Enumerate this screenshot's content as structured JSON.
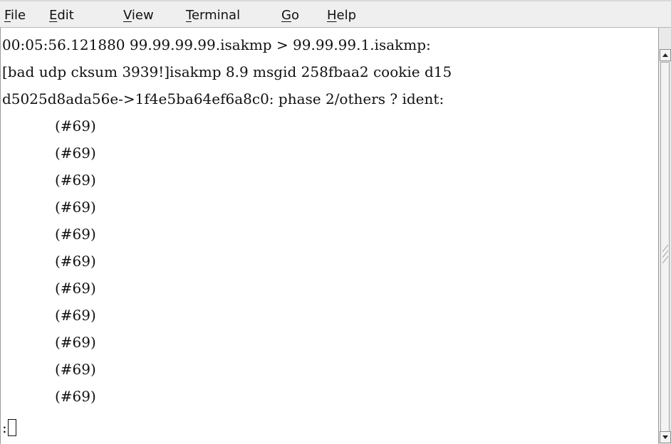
{
  "menubar": {
    "items": [
      {
        "mnemonic": "F",
        "rest": "ile"
      },
      {
        "mnemonic": "E",
        "rest": "dit"
      },
      {
        "mnemonic": "V",
        "rest": "iew"
      },
      {
        "mnemonic": "T",
        "rest": "erminal"
      },
      {
        "mnemonic": "G",
        "rest": "o"
      },
      {
        "mnemonic": "H",
        "rest": "elp"
      }
    ]
  },
  "terminal": {
    "lines": [
      "00:05:56.121880 99.99.99.99.isakmp > 99.99.99.1.isakmp:",
      "[bad udp cksum 3939!]isakmp 8.9 msgid 258fbaa2 cookie d15",
      "d5025d8ada56e->1f4e5ba64ef6a8c0: phase 2/others ? ident:",
      "(#69)",
      "(#69)",
      "(#69)",
      "(#69)",
      "(#69)",
      "(#69)",
      "(#69)",
      "(#69)",
      "(#69)",
      "(#69)",
      "(#69)"
    ],
    "prompt": ":"
  },
  "icons": {
    "scroll_up": "scroll-up-arrow-icon",
    "scroll_down": "scroll-down-arrow-icon",
    "scroll_grip": "scroll-grip-icon"
  }
}
